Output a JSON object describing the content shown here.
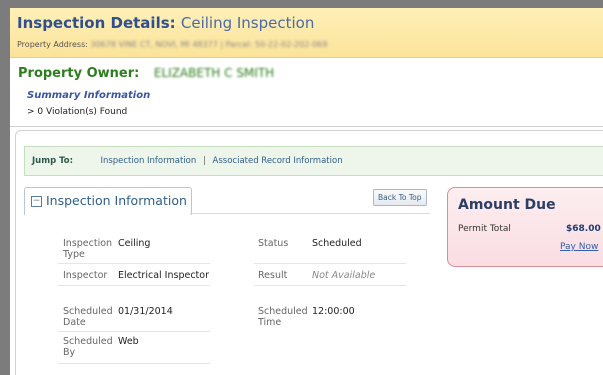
{
  "header": {
    "title_label": "Inspection Details:",
    "title_value": "Ceiling Inspection",
    "address_label": "Property Address:",
    "address_value": "30678 VINE CT, NOVI, MI 48377",
    "parcel_label": "Parcel:",
    "parcel_value": "50-22-02-202-069"
  },
  "owner": {
    "label": "Property Owner:",
    "name": "ELIZABETH C SMITH"
  },
  "summary": {
    "title": "Summary Information",
    "violations": "> 0 Violation(s) Found"
  },
  "jump": {
    "label": "Jump To:",
    "links": [
      "Inspection Information",
      "Associated Record Information"
    ],
    "separator": "|"
  },
  "inspection_tab": {
    "title": "Inspection Information",
    "back_to_top": "Back To Top"
  },
  "fields": {
    "inspection_type": {
      "label": "Inspection Type",
      "value": "Ceiling"
    },
    "status": {
      "label": "Status",
      "value": "Scheduled"
    },
    "inspector": {
      "label": "Inspector",
      "value": "Electrical Inspector"
    },
    "result": {
      "label": "Result",
      "value": "Not Available"
    },
    "scheduled_date": {
      "label": "Scheduled Date",
      "value": "01/31/2014"
    },
    "scheduled_time": {
      "label": "Scheduled Time",
      "value": "12:00:00"
    },
    "scheduled_by": {
      "label": "Scheduled By",
      "value": "Web"
    }
  },
  "amount_due": {
    "title": "Amount Due",
    "permit_label": "Permit Total",
    "permit_value": "$68.00",
    "pay_now": "Pay Now"
  },
  "colors": {
    "owner_green": "#2e7d1e",
    "header_yellow": "#fbe39a",
    "amount_pink": "#f9dde2"
  }
}
